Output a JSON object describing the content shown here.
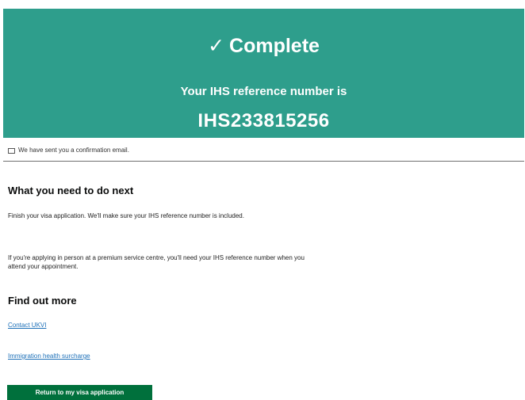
{
  "panel": {
    "tick": "✓",
    "title": "Complete",
    "subtitle": "Your IHS reference number is",
    "reference": "IHS233815256",
    "color": "#2e9e8c"
  },
  "email_note": {
    "icon": "mail-icon",
    "text": "We have sent you a confirmation email."
  },
  "next_steps": {
    "heading": "What you need to do next",
    "para1": "Finish your visa application. We'll make sure your IHS reference number is included.",
    "para2": "If you're applying in person at a premium service centre, you'll need your IHS reference number when you attend your appointment."
  },
  "find_out_more": {
    "heading": "Find out more",
    "links": [
      "Contact UKVI",
      "Immigration health surcharge"
    ]
  },
  "actions": {
    "return_label": "Return to my visa application",
    "button_color": "#00703c"
  }
}
